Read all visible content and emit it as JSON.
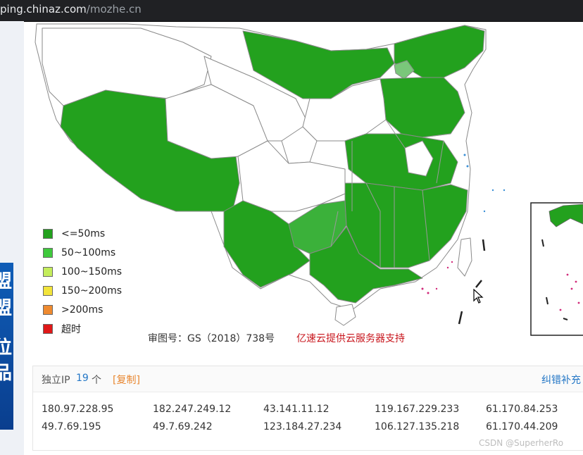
{
  "browser": {
    "url_host": "ping.chinaz.com",
    "url_path": "/mozhe.cn"
  },
  "colors": {
    "fast": "#23a11e",
    "medium": "#3fc93c",
    "slow": "#c4ed5b",
    "slower": "#f2e43b",
    "slowest": "#ef8a2f",
    "timeout": "#e01818",
    "unmeasured": "#ffffff"
  },
  "legend": [
    {
      "label": "<=50ms",
      "color": "#23a11e"
    },
    {
      "label": "50~100ms",
      "color": "#3fc93c"
    },
    {
      "label": "100~150ms",
      "color": "#c4ed5b"
    },
    {
      "label": "150~200ms",
      "color": "#f2e43b"
    },
    {
      "label": ">200ms",
      "color": "#ef8a2f"
    },
    {
      "label": "超时",
      "color": "#e01818"
    }
  ],
  "map": {
    "caption": "审图号：GS（2018）738号",
    "credit": "亿速云提供云服务器支持"
  },
  "ip_panel": {
    "label": "独立IP",
    "count": "19",
    "unit": "个",
    "copy_label": "[复制]",
    "correct_label": "纠错补充",
    "rows": [
      [
        "180.97.228.95",
        "182.247.249.12",
        "43.141.11.12",
        "119.167.229.233",
        "61.170.84.253"
      ],
      [
        "49.7.69.195",
        "49.7.69.242",
        "123.184.27.234",
        "106.127.135.218",
        "61.170.44.209"
      ]
    ]
  },
  "ad": {
    "glyphs": [
      "盟",
      "盟",
      "位",
      "品"
    ]
  },
  "watermark": "CSDN @SuperherRo"
}
